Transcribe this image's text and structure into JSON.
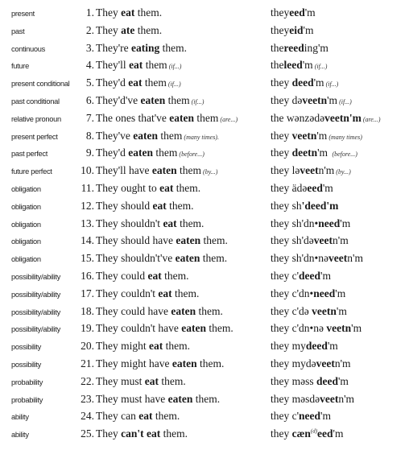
{
  "rows": [
    {
      "label": "present",
      "num": "1.",
      "sentence": [
        [
          "They ",
          ""
        ],
        [
          "eat",
          "b"
        ],
        [
          " them.",
          ""
        ]
      ],
      "pron": [
        [
          "they",
          ""
        ],
        [
          "eed",
          "b"
        ],
        [
          "'m",
          ""
        ]
      ]
    },
    {
      "label": "past",
      "num": "2.",
      "sentence": [
        [
          "They ",
          ""
        ],
        [
          "ate",
          "b"
        ],
        [
          " them.",
          ""
        ]
      ],
      "pron": [
        [
          "they",
          ""
        ],
        [
          "eid",
          "b"
        ],
        [
          "'m",
          ""
        ]
      ]
    },
    {
      "label": "continuous",
      "num": "3.",
      "sentence": [
        [
          "They're ",
          ""
        ],
        [
          "eating",
          "b"
        ],
        [
          " them.",
          ""
        ]
      ],
      "pron": [
        [
          "the",
          ""
        ],
        [
          "reed",
          "b"
        ],
        [
          "ing'm",
          ""
        ]
      ]
    },
    {
      "label": "future",
      "num": "4.",
      "sentence": [
        [
          "They'll ",
          ""
        ],
        [
          "eat",
          "b"
        ],
        [
          " them",
          ""
        ],
        [
          "(if...)",
          "i"
        ]
      ],
      "pron": [
        [
          "the",
          ""
        ],
        [
          "leed",
          "b"
        ],
        [
          "'m",
          ""
        ],
        [
          "(if...)",
          "i"
        ]
      ]
    },
    {
      "label": "present conditional",
      "num": "5.",
      "sentence": [
        [
          "They'd ",
          ""
        ],
        [
          "eat",
          "b"
        ],
        [
          " them",
          ""
        ],
        [
          "(if...)",
          "i"
        ]
      ],
      "pron": [
        [
          "they ",
          ""
        ],
        [
          "deed",
          "b"
        ],
        [
          "'m",
          ""
        ],
        [
          "(if...)",
          "i"
        ]
      ]
    },
    {
      "label": "past conditional",
      "num": "6.",
      "sentence": [
        [
          "They'd've ",
          ""
        ],
        [
          "eaten",
          "b"
        ],
        [
          " them",
          ""
        ],
        [
          "(if...)",
          "i"
        ]
      ],
      "pron": [
        [
          "they də",
          ""
        ],
        [
          "veetn",
          "b"
        ],
        [
          "'m",
          ""
        ],
        [
          "(if...)",
          "i"
        ]
      ]
    },
    {
      "label": "relative pronoun",
      "num": "7.",
      "sentence": [
        [
          "The ones that've ",
          ""
        ],
        [
          "eaten",
          "b"
        ],
        [
          " them",
          ""
        ],
        [
          "(are...)",
          "i"
        ]
      ],
      "pron": [
        [
          "the wənzədə",
          ""
        ],
        [
          "veetn'm",
          "b"
        ],
        [
          "(are...)",
          "i"
        ]
      ]
    },
    {
      "label": "present perfect",
      "num": "8.",
      "sentence": [
        [
          "They've ",
          ""
        ],
        [
          "eaten",
          "b"
        ],
        [
          " them",
          ""
        ],
        [
          "(many times).",
          "i"
        ]
      ],
      "pron": [
        [
          "they ",
          ""
        ],
        [
          "veetn",
          "b"
        ],
        [
          "'m",
          ""
        ],
        [
          "(many times)",
          "i"
        ]
      ]
    },
    {
      "label": "past perfect",
      "num": "9.",
      "sentence": [
        [
          "They'd ",
          ""
        ],
        [
          "eaten",
          "b"
        ],
        [
          " them",
          ""
        ],
        [
          "(before...)",
          "i"
        ]
      ],
      "pron": [
        [
          "they ",
          ""
        ],
        [
          "deetn",
          "b"
        ],
        [
          "'m ",
          ""
        ],
        [
          "(before...)",
          "i"
        ]
      ]
    },
    {
      "label": "future perfect",
      "num": "10.",
      "sentence": [
        [
          "They'll have ",
          ""
        ],
        [
          "eaten",
          "b"
        ],
        [
          " them",
          ""
        ],
        [
          "(by...)",
          "i"
        ]
      ],
      "pron": [
        [
          "they lə",
          ""
        ],
        [
          "veet",
          "b"
        ],
        [
          "n'm",
          ""
        ],
        [
          "(by...)",
          "i"
        ]
      ]
    },
    {
      "label": "obligation",
      "num": "11.",
      "sentence": [
        [
          "They ought to ",
          ""
        ],
        [
          "eat",
          "b"
        ],
        [
          " them.",
          ""
        ]
      ],
      "pron": [
        [
          "they ädə",
          ""
        ],
        [
          "eed",
          "b"
        ],
        [
          "'m",
          ""
        ]
      ]
    },
    {
      "label": "obligation",
      "num": "12.",
      "sentence": [
        [
          "They should ",
          ""
        ],
        [
          "eat",
          "b"
        ],
        [
          " them.",
          ""
        ]
      ],
      "pron": [
        [
          "they sh",
          ""
        ],
        [
          "'deed'm",
          "b"
        ]
      ]
    },
    {
      "label": "obligation",
      "num": "13.",
      "sentence": [
        [
          "They shouldn't ",
          ""
        ],
        [
          "eat",
          "b"
        ],
        [
          " them.",
          ""
        ]
      ],
      "pron": [
        [
          "they sh'dn•",
          ""
        ],
        [
          "need",
          "b"
        ],
        [
          "'m",
          ""
        ]
      ]
    },
    {
      "label": "obligation",
      "num": "14.",
      "sentence": [
        [
          "They should have ",
          ""
        ],
        [
          "eaten",
          "b"
        ],
        [
          " them.",
          ""
        ]
      ],
      "pron": [
        [
          "they sh'də",
          ""
        ],
        [
          "veet",
          "b"
        ],
        [
          "n'm",
          ""
        ]
      ]
    },
    {
      "label": "obligation",
      "num": "15.",
      "sentence": [
        [
          "They shouldn't've ",
          ""
        ],
        [
          "eaten",
          "b"
        ],
        [
          " them.",
          ""
        ]
      ],
      "pron": [
        [
          "they sh'dn•nə",
          ""
        ],
        [
          "veet",
          "b"
        ],
        [
          "n'm",
          ""
        ]
      ]
    },
    {
      "label": "possibility/ability",
      "num": "16.",
      "sentence": [
        [
          "They could ",
          ""
        ],
        [
          "eat",
          "b"
        ],
        [
          " them.",
          ""
        ]
      ],
      "pron": [
        [
          "they c'",
          ""
        ],
        [
          "deed",
          "b"
        ],
        [
          "'m",
          ""
        ]
      ]
    },
    {
      "label": "possibility/ability",
      "num": "17.",
      "sentence": [
        [
          "They couldn't ",
          ""
        ],
        [
          "eat",
          "b"
        ],
        [
          " them.",
          ""
        ]
      ],
      "pron": [
        [
          "they c'dn•",
          ""
        ],
        [
          "need",
          "b"
        ],
        [
          "'m",
          ""
        ]
      ]
    },
    {
      "label": "possibility/ability",
      "num": "18.",
      "sentence": [
        [
          "They could have ",
          ""
        ],
        [
          "eaten",
          "b"
        ],
        [
          " them.",
          ""
        ]
      ],
      "pron": [
        [
          "they c'də ",
          ""
        ],
        [
          "veetn",
          "b"
        ],
        [
          "'m",
          ""
        ]
      ]
    },
    {
      "label": "possibility/ability",
      "num": "19.",
      "sentence": [
        [
          "They couldn't have ",
          ""
        ],
        [
          "eaten",
          "b"
        ],
        [
          " them.",
          ""
        ]
      ],
      "pron": [
        [
          "they c'dn•nə ",
          ""
        ],
        [
          "veetn",
          "b"
        ],
        [
          "'m",
          ""
        ]
      ]
    },
    {
      "label": "possibility",
      "num": "20.",
      "sentence": [
        [
          "They might ",
          ""
        ],
        [
          "eat",
          "b"
        ],
        [
          " them.",
          ""
        ]
      ],
      "pron": [
        [
          "they my",
          ""
        ],
        [
          "deed",
          "b"
        ],
        [
          "'m",
          ""
        ]
      ]
    },
    {
      "label": "possibility",
      "num": "21.",
      "sentence": [
        [
          "They might have ",
          ""
        ],
        [
          "eaten",
          "b"
        ],
        [
          " them.",
          ""
        ]
      ],
      "pron": [
        [
          "they mydə",
          ""
        ],
        [
          "veet",
          "b"
        ],
        [
          "n'm",
          ""
        ]
      ]
    },
    {
      "label": "probability",
      "num": "22.",
      "sentence": [
        [
          "They must ",
          ""
        ],
        [
          "eat",
          "b"
        ],
        [
          " them.",
          ""
        ]
      ],
      "pron": [
        [
          "they məss ",
          ""
        ],
        [
          "deed",
          "b"
        ],
        [
          "'m",
          ""
        ]
      ]
    },
    {
      "label": "probability",
      "num": "23.",
      "sentence": [
        [
          "They must have ",
          ""
        ],
        [
          "eaten",
          "b"
        ],
        [
          " them.",
          ""
        ]
      ],
      "pron": [
        [
          "they məsdə",
          ""
        ],
        [
          "veet",
          "b"
        ],
        [
          "n'm",
          ""
        ]
      ]
    },
    {
      "label": "ability",
      "num": "24.",
      "sentence": [
        [
          "They can ",
          ""
        ],
        [
          "eat",
          "b"
        ],
        [
          " them.",
          ""
        ]
      ],
      "pron": [
        [
          "they c'",
          ""
        ],
        [
          "need",
          "b"
        ],
        [
          "'m",
          ""
        ]
      ]
    },
    {
      "label": "ability",
      "num": "25.",
      "sentence": [
        [
          "They ",
          ""
        ],
        [
          "can't eat",
          "b"
        ],
        [
          " them.",
          ""
        ]
      ],
      "pron": [
        [
          "they ",
          ""
        ],
        [
          "cæn",
          "b"
        ],
        [
          "(d)",
          "sup"
        ],
        [
          "eed",
          "b"
        ],
        [
          "'m",
          ""
        ]
      ]
    }
  ]
}
